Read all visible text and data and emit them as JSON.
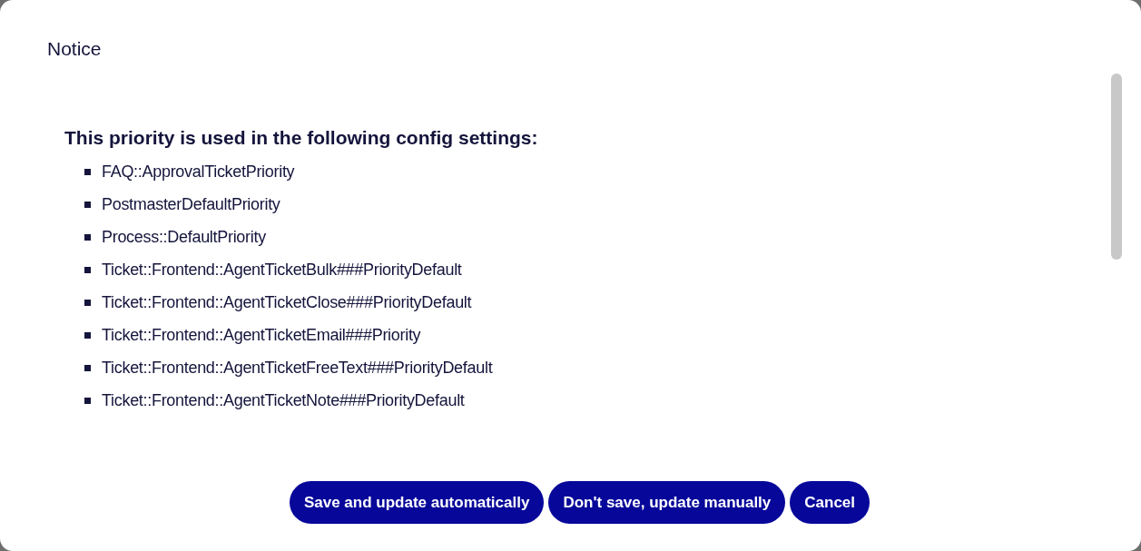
{
  "dialog": {
    "title": "Notice",
    "heading": "This priority is used in the following config settings:",
    "settings": [
      "FAQ::ApprovalTicketPriority",
      "PostmasterDefaultPriority",
      "Process::DefaultPriority",
      "Ticket::Frontend::AgentTicketBulk###PriorityDefault",
      "Ticket::Frontend::AgentTicketClose###PriorityDefault",
      "Ticket::Frontend::AgentTicketEmail###Priority",
      "Ticket::Frontend::AgentTicketFreeText###PriorityDefault",
      "Ticket::Frontend::AgentTicketNote###PriorityDefault"
    ],
    "buttons": [
      "Save and update automatically",
      "Don't save, update manually",
      "Cancel"
    ]
  }
}
